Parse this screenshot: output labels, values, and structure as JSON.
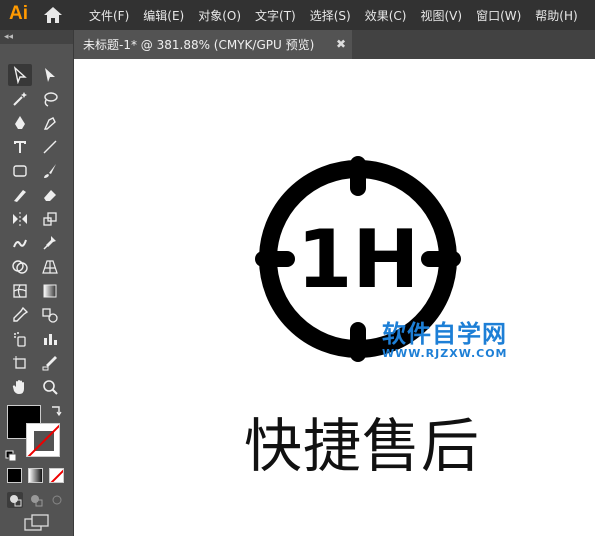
{
  "app": {
    "logo": "Ai"
  },
  "menu": [
    "文件(F)",
    "编辑(E)",
    "对象(O)",
    "文字(T)",
    "选择(S)",
    "效果(C)",
    "视图(V)",
    "窗口(W)",
    "帮助(H)"
  ],
  "toolbar": {
    "collapse": "◂◂"
  },
  "document_tab": {
    "title": "未标题-1* @ 381.88% (CMYK/GPU 预览)",
    "close": "✖"
  },
  "artwork": {
    "icon_text": "1H",
    "caption": "快捷售后",
    "watermark": "软件自学网",
    "watermark_url": "WWW.RJZXW.COM"
  },
  "colors": {
    "fill": "#000000",
    "stroke": "#ffffff",
    "watermark": "#1d7fd6",
    "logo": "#ff9a00"
  }
}
